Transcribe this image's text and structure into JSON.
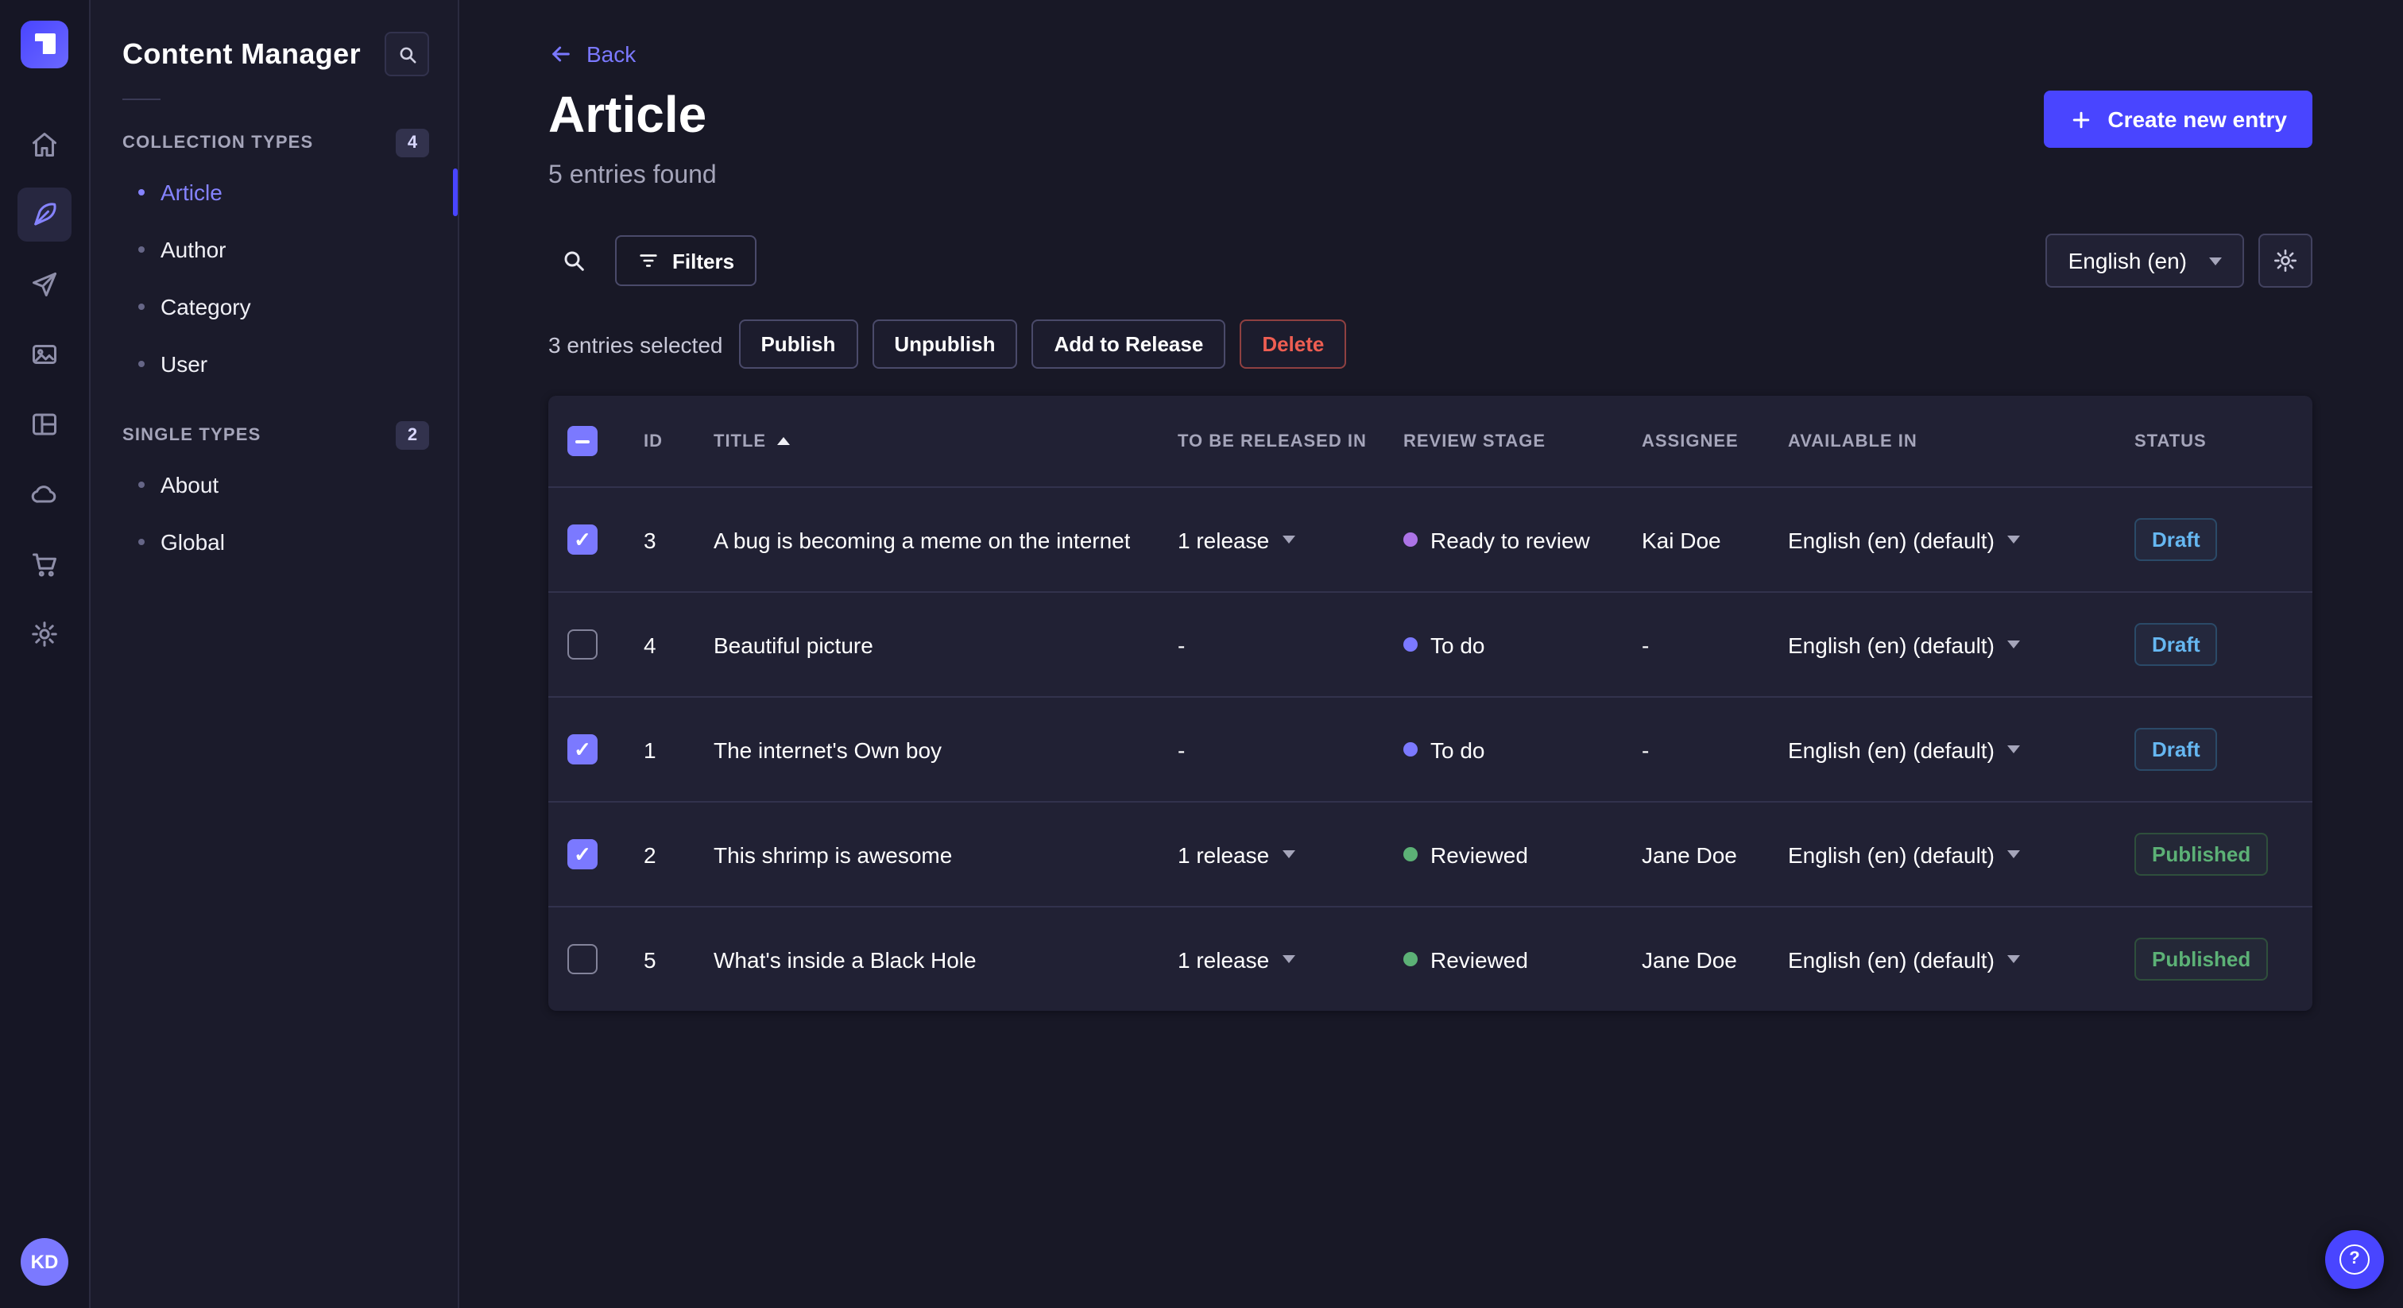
{
  "nav_rail": {
    "icons": [
      "home",
      "content-manager",
      "releases",
      "media-library",
      "content-type-builder",
      "deploy",
      "marketplace",
      "settings"
    ],
    "avatar_initials": "KD"
  },
  "sidebar": {
    "title": "Content Manager",
    "sections": [
      {
        "label": "COLLECTION TYPES",
        "count": "4",
        "items": [
          {
            "label": "Article",
            "active": true
          },
          {
            "label": "Author",
            "active": false
          },
          {
            "label": "Category",
            "active": false
          },
          {
            "label": "User",
            "active": false
          }
        ]
      },
      {
        "label": "SINGLE TYPES",
        "count": "2",
        "items": [
          {
            "label": "About",
            "active": false
          },
          {
            "label": "Global",
            "active": false
          }
        ]
      }
    ]
  },
  "header": {
    "back_label": "Back",
    "title": "Article",
    "subtitle": "5 entries found",
    "create_button_label": "Create new entry"
  },
  "toolbar": {
    "filters_label": "Filters",
    "locale_value": "English (en)"
  },
  "selection": {
    "text": "3 entries selected",
    "publish_label": "Publish",
    "unpublish_label": "Unpublish",
    "add_to_release_label": "Add to Release",
    "delete_label": "Delete"
  },
  "table": {
    "columns": [
      "ID",
      "TITLE",
      "TO BE RELEASED IN",
      "REVIEW STAGE",
      "ASSIGNEE",
      "AVAILABLE IN",
      "STATUS"
    ],
    "sorted_column": "TITLE",
    "sort_direction": "asc",
    "rows": [
      {
        "selected": true,
        "id": "3",
        "title": "A bug is becoming a meme on the internet",
        "release": "1 release",
        "stage": "Ready to review",
        "stage_color": "#ac73e6",
        "assignee": "Kai Doe",
        "locale": "English (en) (default)",
        "status": "Draft"
      },
      {
        "selected": false,
        "id": "4",
        "title": "Beautiful picture",
        "release": "-",
        "stage": "To do",
        "stage_color": "#7b79ff",
        "assignee": "-",
        "locale": "English (en) (default)",
        "status": "Draft"
      },
      {
        "selected": true,
        "id": "1",
        "title": "The internet's Own boy",
        "release": "-",
        "stage": "To do",
        "stage_color": "#7b79ff",
        "assignee": "-",
        "locale": "English (en) (default)",
        "status": "Draft"
      },
      {
        "selected": true,
        "id": "2",
        "title": "This shrimp is awesome",
        "release": "1 release",
        "stage": "Reviewed",
        "stage_color": "#5cb176",
        "assignee": "Jane Doe",
        "locale": "English (en) (default)",
        "status": "Published"
      },
      {
        "selected": false,
        "id": "5",
        "title": "What's inside a Black Hole",
        "release": "1 release",
        "stage": "Reviewed",
        "stage_color": "#5cb176",
        "assignee": "Jane Doe",
        "locale": "English (en) (default)",
        "status": "Published"
      }
    ]
  },
  "help_label": "?",
  "colors": {
    "primary": "#4945ff",
    "accent_text": "#7b79ff",
    "draft": "#66b7f1",
    "published": "#5cb176",
    "danger": "#ee5e52",
    "stage_todo": "#7b79ff",
    "stage_ready_to_review": "#ac73e6",
    "stage_reviewed": "#5cb176"
  }
}
